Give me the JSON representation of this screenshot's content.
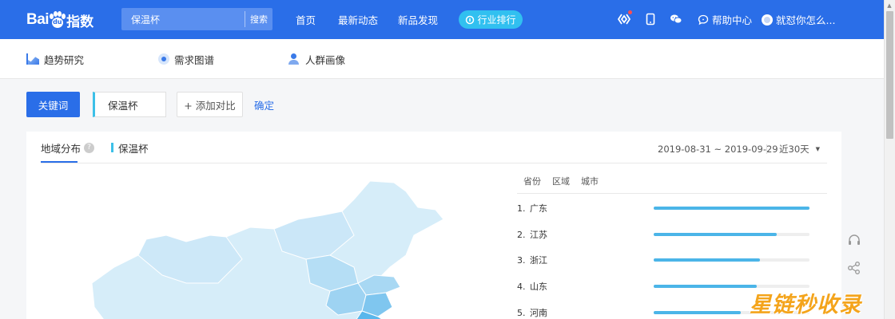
{
  "topbar": {
    "logo_latin_left": "Bai",
    "logo_latin_paw": "du",
    "logo_cn": "指数",
    "search_value": "保温杯",
    "search_button": "搜索",
    "nav": [
      "首页",
      "最新动态",
      "新品发现"
    ],
    "pill_label": "行业排行",
    "help_label": "帮助中心",
    "user_name": "就怼你怎么..."
  },
  "subnav": {
    "items": [
      "趋势研究",
      "需求图谱",
      "人群画像"
    ]
  },
  "keyword": {
    "button": "关键词",
    "value": "保温杯",
    "add_compare": "+ 添加对比",
    "confirm": "确定"
  },
  "card": {
    "tab_label": "地域分布",
    "series_label": "保温杯",
    "date_range": "2019-08-31 ~ 2019-09-29",
    "period": "近30天",
    "region_tabs": [
      "省份",
      "区域",
      "城市"
    ],
    "ranks": [
      {
        "idx": "1.",
        "name": "广东",
        "value": 100
      },
      {
        "idx": "2.",
        "name": "江苏",
        "value": 79
      },
      {
        "idx": "3.",
        "name": "浙江",
        "value": 68
      },
      {
        "idx": "4.",
        "name": "山东",
        "value": 66
      },
      {
        "idx": "5.",
        "name": "河南",
        "value": 56
      }
    ]
  },
  "colors": {
    "brand": "#2a6ee8",
    "accent": "#3cc0e8",
    "bar": "#4bb5e8",
    "map_light": "#d6edf9",
    "map_mid": "#a8d8f3",
    "map_dark": "#5ab7ec"
  },
  "watermark": "星链秒收录"
}
